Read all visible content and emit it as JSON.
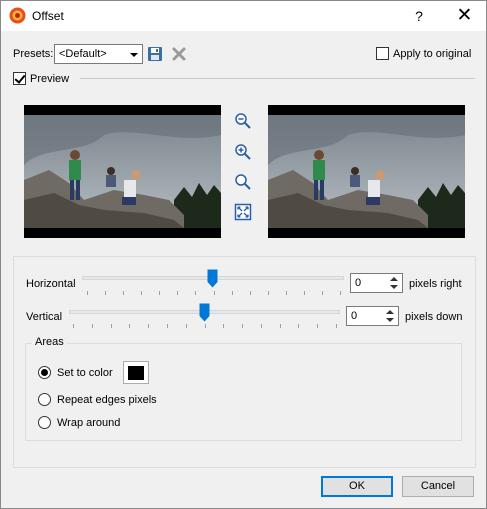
{
  "window": {
    "title": "Offset",
    "help_label": "?",
    "close_label": "✕"
  },
  "presets": {
    "label": "Presets:",
    "selected": "<Default>",
    "save_icon": "save-icon",
    "delete_icon": "delete-icon"
  },
  "apply_to_original": {
    "label": "Apply to original",
    "checked": false
  },
  "preview": {
    "label": "Preview",
    "checked": true
  },
  "tools": [
    "zoom-out-icon",
    "zoom-in-icon",
    "zoom-actual-icon",
    "fit-to-window-icon"
  ],
  "horizontal": {
    "label": "Horizontal",
    "value": "0",
    "unit": "pixels right",
    "level": 0.5
  },
  "vertical": {
    "label": "Vertical",
    "value": "0",
    "unit": "pixels down",
    "level": 0.5
  },
  "areas": {
    "label": "Areas",
    "options": [
      {
        "label": "Set to color",
        "selected": true
      },
      {
        "label": "Repeat edges pixels",
        "selected": false
      },
      {
        "label": "Wrap around",
        "selected": false
      }
    ],
    "color": "#000000"
  },
  "buttons": {
    "ok": "OK",
    "cancel": "Cancel"
  },
  "colors": {
    "accent": "#0078d7",
    "sky": "#8a939a",
    "rock": "#6f6a63"
  }
}
